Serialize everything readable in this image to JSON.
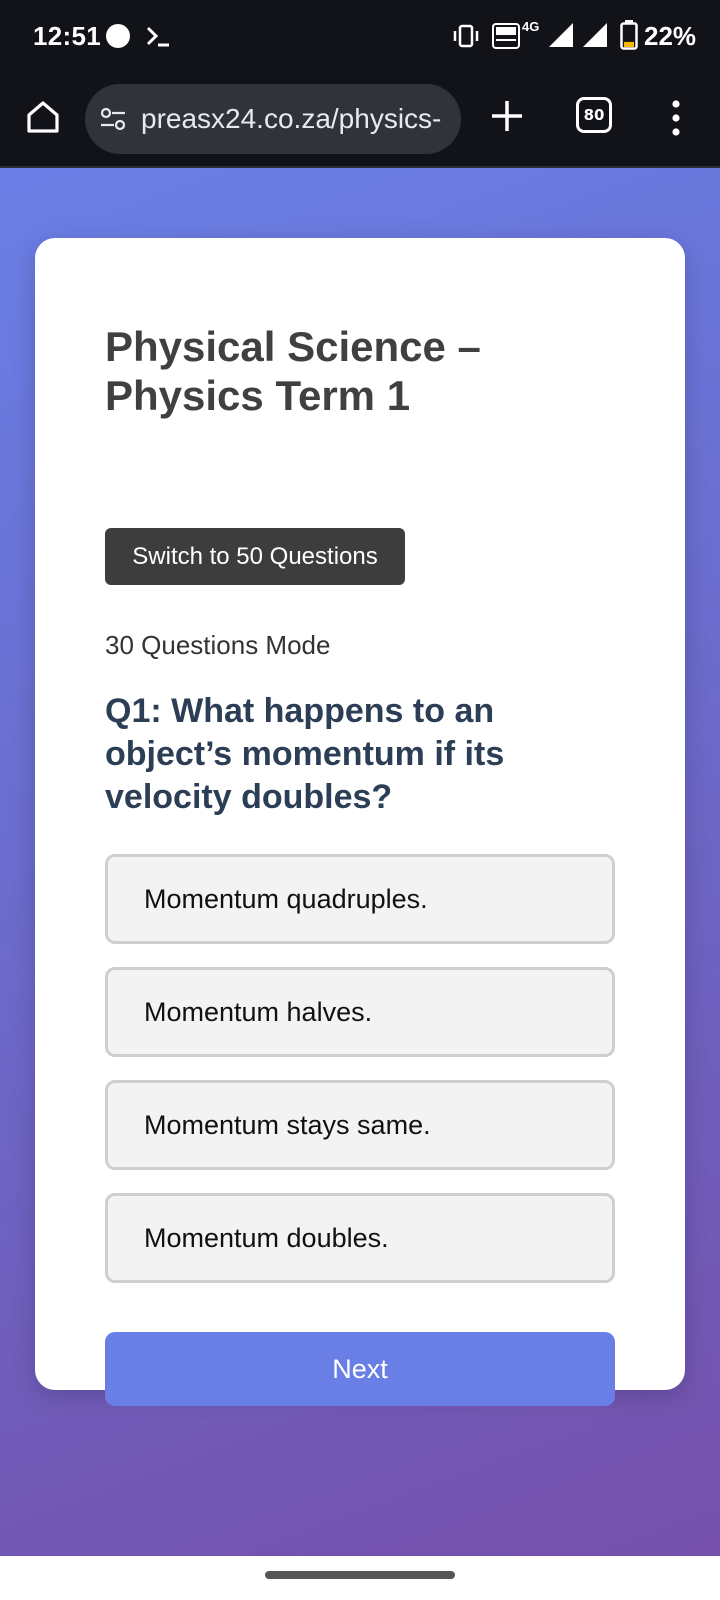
{
  "status_bar": {
    "time": "12:51",
    "network": "4G",
    "battery_percent": "22%",
    "battery_level": 0.22
  },
  "browser": {
    "url": "preasx24.co.za/physics-",
    "tab_count": "80"
  },
  "quiz": {
    "title": "Physical Science – Physics Term 1",
    "switch_label": "Switch to 50 Questions",
    "mode": "30 Questions Mode",
    "question": "Q1: What happens to an object’s momentum if its velocity doubles?",
    "options": [
      "Momentum quadruples.",
      "Momentum halves.",
      "Momentum stays same.",
      "Momentum doubles."
    ],
    "next_label": "Next"
  },
  "colors": {
    "accent": "#6a7fe6",
    "gradient_end": "#7550ab",
    "switch_button": "#3d3d3d",
    "question_text": "#2c3e55"
  }
}
